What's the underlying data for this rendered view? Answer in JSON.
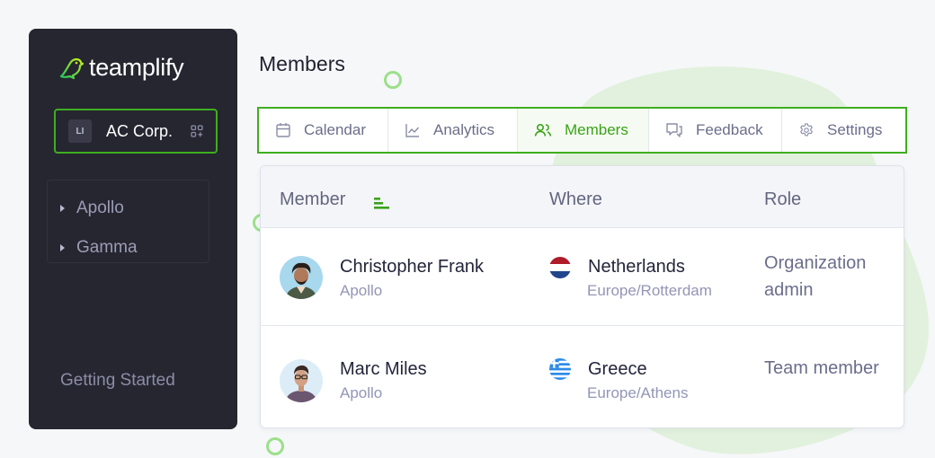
{
  "brand": {
    "name": "teamplify",
    "accent": "#3fae1f"
  },
  "sidebar": {
    "org": {
      "badge": "LI",
      "name": "AC Corp."
    },
    "projects": [
      {
        "label": "Apollo"
      },
      {
        "label": "Gamma"
      }
    ],
    "footer_link": "Getting Started"
  },
  "main": {
    "title": "Members",
    "tabs": [
      {
        "label": "Calendar",
        "icon": "calendar-icon",
        "active": false
      },
      {
        "label": "Analytics",
        "icon": "chart-line-icon",
        "active": false
      },
      {
        "label": "Members",
        "icon": "users-icon",
        "active": true
      },
      {
        "label": "Feedback",
        "icon": "chat-icon",
        "active": false
      },
      {
        "label": "Settings",
        "icon": "gear-icon",
        "active": false
      }
    ],
    "table": {
      "columns": [
        "Member",
        "Where",
        "Role"
      ],
      "rows": [
        {
          "name": "Christopher Frank",
          "team": "Apollo",
          "country": "Netherlands",
          "timezone": "Europe/Rotterdam",
          "role_line1": "Organization",
          "role_line2": "admin"
        },
        {
          "name": "Marc Miles",
          "team": "Apollo",
          "country": "Greece",
          "timezone": "Europe/Athens",
          "role_line1": "Team member",
          "role_line2": ""
        }
      ]
    }
  }
}
